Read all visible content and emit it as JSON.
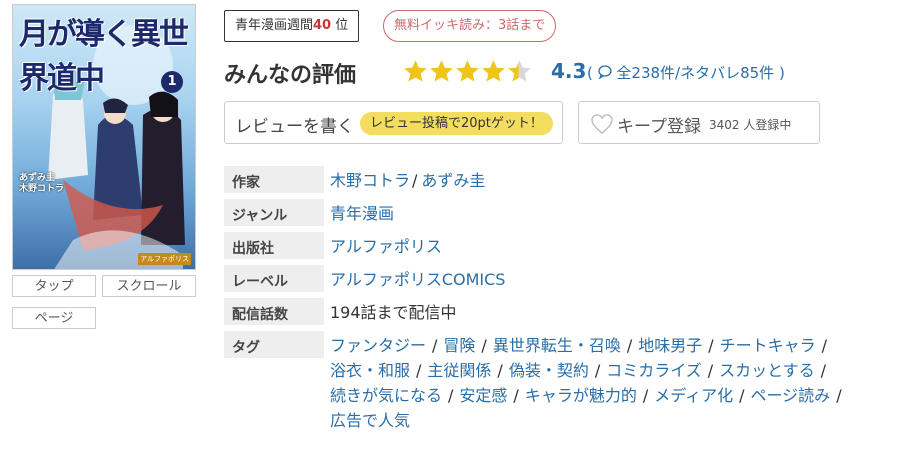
{
  "cover": {
    "title": "月が導く異世界道中",
    "volume": "1",
    "authors": [
      "あずみ圭",
      "木野コトラ"
    ],
    "publisher": "アルファポリス"
  },
  "view_modes": {
    "tap": "タップ",
    "scroll": "スクロール",
    "page": "ページ"
  },
  "rank_badge": {
    "prefix": "青年漫画週間",
    "rank": "40",
    "suffix": "位"
  },
  "free_badge": "無料イッキ読み：3話まで",
  "rating": {
    "title": "みんなの評価",
    "stars": 4.3,
    "score": "4.3",
    "reviews": "全238件/ネタバレ85件",
    "star_color": "#f0c419"
  },
  "review_button": {
    "label": "レビューを書く",
    "promo": "レビュー投稿で20ptゲット！"
  },
  "keep_button": {
    "label": "キープ登録",
    "count": "3402 人登録中"
  },
  "info": {
    "author_label": "作家",
    "authors": [
      "木野コトラ",
      "あずみ圭"
    ],
    "genre_label": "ジャンル",
    "genre": "青年漫画",
    "publisher_label": "出版社",
    "publisher": "アルファポリス",
    "label_label": "レーベル",
    "label": "アルファポリスCOMICS",
    "episodes_label": "配信話数",
    "episodes": "194話まで配信中",
    "tags_label": "タグ",
    "tags": [
      "ファンタジー",
      "冒険",
      "異世界転生・召喚",
      "地味男子",
      "チートキャラ",
      "浴衣・和服",
      "主従関係",
      "偽装・契約",
      "コミカライズ",
      "スカッとする",
      "続きが気になる",
      "安定感",
      "キャラが魅力的",
      "メディア化",
      "ページ読み",
      "広告で人気"
    ]
  },
  "colors": {
    "link": "#2a6ea8",
    "rank_red": "#cc3333",
    "promo_yellow": "#f3dd5e"
  }
}
